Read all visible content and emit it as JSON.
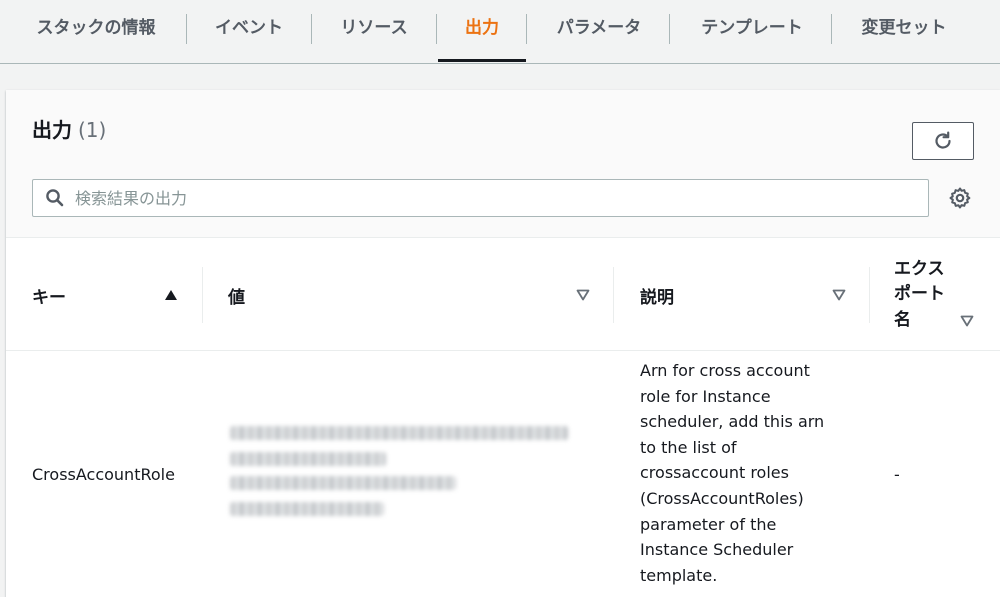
{
  "tabs": [
    {
      "label": "スタックの情報",
      "active": false
    },
    {
      "label": "イベント",
      "active": false
    },
    {
      "label": "リソース",
      "active": false
    },
    {
      "label": "出力",
      "active": true
    },
    {
      "label": "パラメータ",
      "active": false
    },
    {
      "label": "テンプレート",
      "active": false
    },
    {
      "label": "変更セット",
      "active": false
    }
  ],
  "panel": {
    "title": "出力",
    "count": "(1)",
    "search_placeholder": "検索結果の出力"
  },
  "table": {
    "columns": [
      {
        "label": "キー",
        "sort": "ascending"
      },
      {
        "label": "値",
        "sort": "none"
      },
      {
        "label": "説明",
        "sort": "none"
      },
      {
        "label": "エクスポート名",
        "label_lines": [
          "エクス",
          "ポート",
          "名"
        ],
        "sort": "none"
      }
    ],
    "rows": [
      {
        "key": "CrossAccountRole",
        "value": "",
        "description_lines": [
          "Arn for cross account",
          "role for Instance",
          "scheduler, add this arn",
          "to the list of",
          "crossaccount roles",
          "(CrossAccountRoles)",
          "parameter of the",
          "Instance Scheduler",
          "template."
        ],
        "export_name": "-"
      }
    ]
  },
  "colors": {
    "accent": "#ec7211",
    "text": "#16191f",
    "muted": "#687078",
    "border": "#aab7b8",
    "background": "#f2f3f3"
  },
  "icons": {
    "refresh": "refresh-icon",
    "search": "search-icon",
    "settings": "gear-icon",
    "sort_asc": "sort-ascending-icon",
    "sort_none": "sort-descending-outline-icon"
  }
}
